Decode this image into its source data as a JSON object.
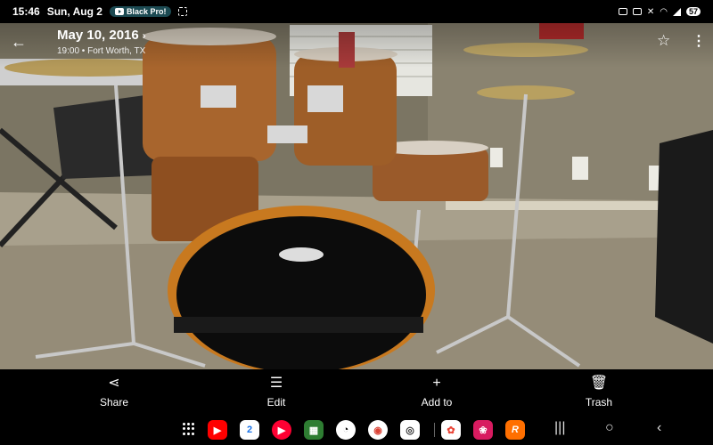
{
  "status_bar": {
    "time": "15:46",
    "date": "Sun, Aug 2",
    "notification": "Black Pro!",
    "battery": "57"
  },
  "photo_header": {
    "date": "May 10, 2016",
    "chevron": "›",
    "details": "19:00 • Fort Worth, TX"
  },
  "actions": [
    {
      "label": "Share",
      "icon": "share-icon"
    },
    {
      "label": "Edit",
      "icon": "edit-icon"
    },
    {
      "label": "Add to",
      "icon": "plus-icon"
    },
    {
      "label": "Trash",
      "icon": "trash-icon"
    }
  ],
  "dock_apps": [
    {
      "name": "youtube",
      "color": "#ff0000"
    },
    {
      "name": "calendar",
      "color": "#ffffff",
      "text": "2"
    },
    {
      "name": "youtube-music",
      "color": "#ff0033"
    },
    {
      "name": "phone-link",
      "color": "#2e7d32"
    },
    {
      "name": "clock",
      "color": "#ffffff"
    },
    {
      "name": "chrome",
      "color": "#ffffff"
    },
    {
      "name": "camera",
      "color": "#ffffff"
    },
    {
      "name": "photos",
      "color": "#ffffff"
    },
    {
      "name": "blossom",
      "color": "#d81b60"
    },
    {
      "name": "reddit",
      "color": "#ff6f00",
      "text": "R"
    }
  ]
}
